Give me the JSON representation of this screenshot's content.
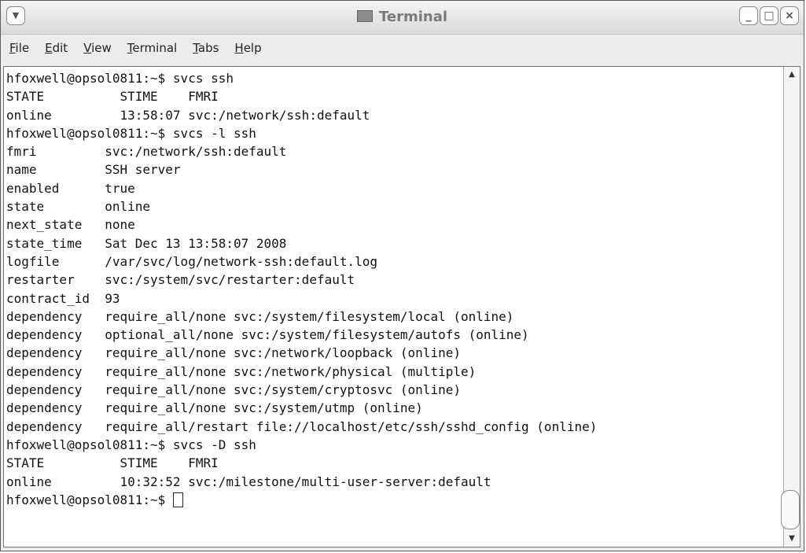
{
  "window": {
    "title": "Terminal"
  },
  "menubar": {
    "file": "File",
    "edit": "Edit",
    "view": "View",
    "terminal": "Terminal",
    "tabs": "Tabs",
    "help": "Help"
  },
  "terminal": {
    "lines": [
      "hfoxwell@opsol0811:~$ svcs ssh",
      "STATE          STIME    FMRI",
      "online         13:58:07 svc:/network/ssh:default",
      "hfoxwell@opsol0811:~$ svcs -l ssh",
      "fmri         svc:/network/ssh:default",
      "name         SSH server",
      "enabled      true",
      "state        online",
      "next_state   none",
      "state_time   Sat Dec 13 13:58:07 2008",
      "logfile      /var/svc/log/network-ssh:default.log",
      "restarter    svc:/system/svc/restarter:default",
      "contract_id  93",
      "dependency   require_all/none svc:/system/filesystem/local (online)",
      "dependency   optional_all/none svc:/system/filesystem/autofs (online)",
      "dependency   require_all/none svc:/network/loopback (online)",
      "dependency   require_all/none svc:/network/physical (multiple)",
      "dependency   require_all/none svc:/system/cryptosvc (online)",
      "dependency   require_all/none svc:/system/utmp (online)",
      "dependency   require_all/restart file://localhost/etc/ssh/sshd_config (online)",
      "hfoxwell@opsol0811:~$ svcs -D ssh",
      "STATE          STIME    FMRI",
      "online         10:32:52 svc:/milestone/multi-user-server:default"
    ],
    "prompt": "hfoxwell@opsol0811:~$ "
  }
}
